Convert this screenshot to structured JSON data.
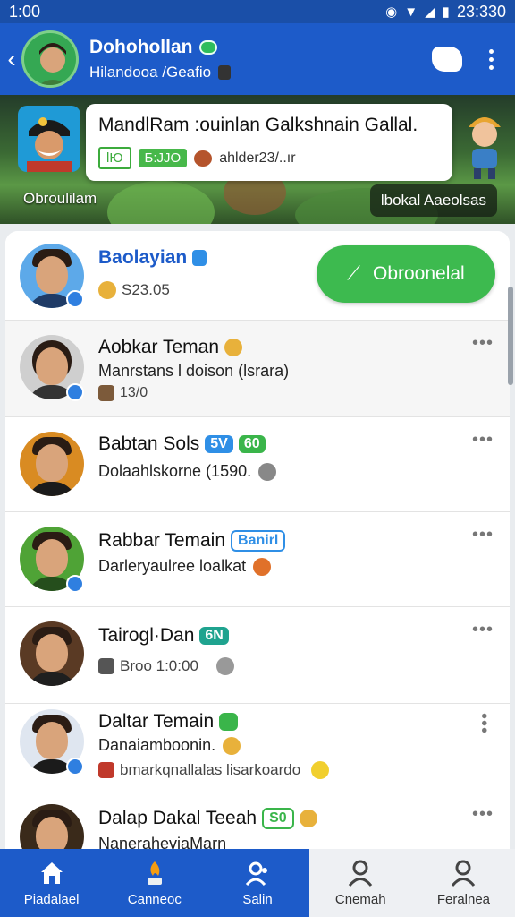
{
  "status_bar": {
    "time": "1:00",
    "clock": "23:330"
  },
  "app_bar": {
    "title": "Dohohollan",
    "subtitle": "Hilandooa /Geafio"
  },
  "banner": {
    "headline": "MandlRam :ouinlan Galkshnain Gallal.",
    "tag_one": "lЮ",
    "tag_two": "Б:ЈЈO",
    "handle": "ahlder23/..ır",
    "label": "Obroulilam",
    "button_label": "lbokal Aaeolsas"
  },
  "featured": {
    "name": "Baolayian",
    "amount": "S23.05",
    "action_label": "Obroonelal",
    "action_icon": "ticket-icon"
  },
  "contacts": [
    {
      "name": "Aobkar Teman",
      "line": "Manrstans l doison (lsrara)",
      "meta": "13/0"
    },
    {
      "name": "Babtan Sols",
      "badge_one": "5V",
      "badge_two": "60",
      "line": "Dolaahlskorne (1590.",
      "meta": ""
    },
    {
      "name": "Rabbar Temain",
      "badge_one": "Banirl",
      "line": "Darleryaulree loalkat",
      "meta": ""
    },
    {
      "name": "Tairogl·Dan",
      "badge_one": "6N",
      "line": "",
      "meta": "Broo 1:0:00"
    },
    {
      "name": "Daltar Temain",
      "line": "Danaiamboonin.",
      "meta": "bmarkqnallalas lisarkoardo"
    },
    {
      "name": "Dalap Dakal Teeah",
      "badge_one": "S0",
      "line": "NaneraheviaMarn",
      "meta": ""
    }
  ],
  "bottom_nav": [
    {
      "label": "Piadalael",
      "icon": "home-icon"
    },
    {
      "label": "Canneoc",
      "icon": "campfire-icon"
    },
    {
      "label": "Salin",
      "icon": "search-person-icon"
    },
    {
      "label": "Cnemah",
      "icon": "person-icon"
    },
    {
      "label": "Feralnea",
      "icon": "profile-icon"
    }
  ],
  "colors": {
    "primary": "#1d5bc9",
    "accent": "#3dba4f",
    "status_bar": "#1a4fa8"
  }
}
